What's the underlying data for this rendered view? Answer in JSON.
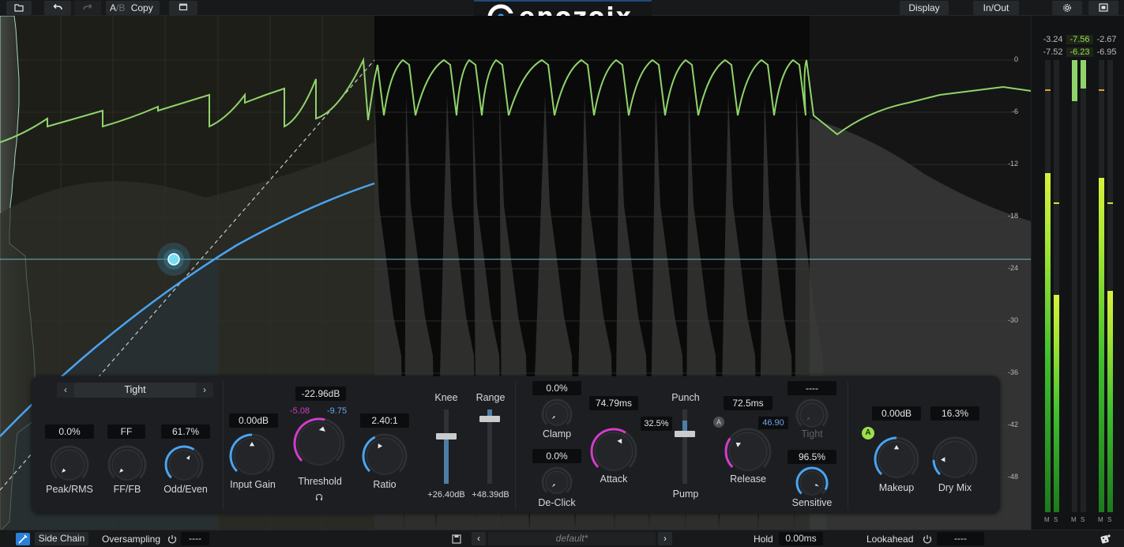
{
  "brand": {
    "name": "enozoix"
  },
  "toolbar": {
    "ab_a": "A",
    "ab_sep": "/",
    "ab_b": "B",
    "copy_label": "Copy",
    "display_label": "Display",
    "inout_label": "In/Out"
  },
  "graph": {
    "db_labels": [
      "0",
      "-6",
      "-12",
      "-18",
      "-24",
      "-30",
      "-36",
      "-42",
      "-48"
    ]
  },
  "meters": {
    "in_peak": "-3.24",
    "in_rms": "-7.52",
    "gr_peak": "-7.56",
    "gr_rms": "-6.23",
    "out_peak": "-2.67",
    "out_rms": "-6.95",
    "ms_m": "M",
    "ms_s": "S"
  },
  "detector": {
    "mode": "Tight",
    "peak_rms_value": "0.0%",
    "peak_rms_label": "Peak/RMS",
    "fffb_value": "FF",
    "fffb_label": "FF/FB",
    "odd_even_value": "61.7%",
    "odd_even_label": "Odd/Even"
  },
  "main": {
    "input_gain_value": "0.00dB",
    "input_gain_label": "Input Gain",
    "threshold_value": "-22.96dB",
    "threshold_low": "-5.08",
    "threshold_high": "-9.75",
    "threshold_label": "Threshold",
    "ratio_value": "2.40:1",
    "ratio_label": "Ratio",
    "knee_label": "Knee",
    "knee_value": "+26.40dB",
    "range_label": "Range",
    "range_value": "+48.39dB"
  },
  "timing": {
    "clamp_value": "0.0%",
    "clamp_label": "Clamp",
    "declick_value": "0.0%",
    "declick_label": "De-Click",
    "attack_value": "74.79ms",
    "attack_label": "Attack",
    "punch_label": "Punch",
    "punch_value": "32.5%",
    "pump_label": "Pump",
    "release_value": "72.5ms",
    "release_auto_value": "46.90",
    "release_label": "Release",
    "auto_badge": "A",
    "tight_value": "----",
    "tight_label": "Tight",
    "sensitive_value": "96.5%",
    "sensitive_label": "Sensitive"
  },
  "output": {
    "auto_badge": "A",
    "makeup_value": "0.00dB",
    "makeup_label": "Makeup",
    "drymix_value": "16.3%",
    "drymix_label": "Dry Mix"
  },
  "bottom": {
    "sidechain_label": "Side Chain",
    "oversampling_label": "Oversampling",
    "oversampling_value": "----",
    "preset_name": "default*",
    "hold_label": "Hold",
    "hold_value": "0.00ms",
    "lookahead_label": "Lookahead",
    "lookahead_value": "----"
  },
  "colors": {
    "accent_blue": "#4aa3f0",
    "accent_magenta": "#d23cc8",
    "curve_green": "#8fd46a",
    "auto_green": "#9be04a"
  }
}
